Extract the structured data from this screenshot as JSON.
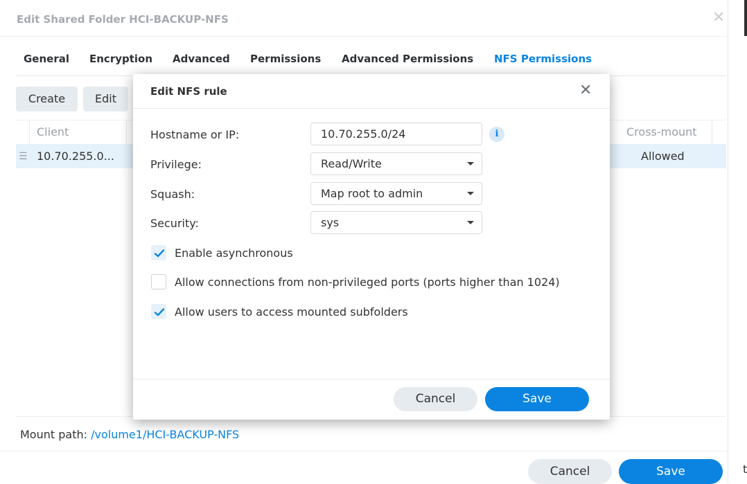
{
  "window": {
    "title": "Edit Shared Folder HCI-BACKUP-NFS",
    "close_icon": "close-icon"
  },
  "tabs": [
    {
      "label": "General"
    },
    {
      "label": "Encryption"
    },
    {
      "label": "Advanced"
    },
    {
      "label": "Permissions"
    },
    {
      "label": "Advanced Permissions"
    },
    {
      "label": "NFS Permissions",
      "active": true
    }
  ],
  "toolbar": {
    "create_label": "Create",
    "edit_label": "Edit"
  },
  "grid": {
    "columns": [
      "Client",
      "Cross-mount"
    ],
    "rows": [
      {
        "client": "10.70.255.0...",
        "cross_mount": "Allowed"
      }
    ]
  },
  "mount": {
    "label": "Mount path:",
    "path": "/volume1/HCI-BACKUP-NFS"
  },
  "footer": {
    "cancel_label": "Cancel",
    "save_label": "Save"
  },
  "dialog": {
    "title": "Edit NFS rule",
    "fields": {
      "hostname": {
        "label": "Hostname or IP:",
        "value": "10.70.255.0/24"
      },
      "privilege": {
        "label": "Privilege:",
        "value": "Read/Write"
      },
      "squash": {
        "label": "Squash:",
        "value": "Map root to admin"
      },
      "security": {
        "label": "Security:",
        "value": "sys"
      }
    },
    "options": [
      {
        "label": "Enable asynchronous",
        "checked": true
      },
      {
        "label": "Allow connections from non-privileged ports (ports higher than 1024)",
        "checked": false
      },
      {
        "label": "Allow users to access mounted subfolders",
        "checked": true
      }
    ],
    "cancel_label": "Cancel",
    "save_label": "Save"
  },
  "background_edge_text": "t",
  "colors": {
    "accent": "#0a84e0",
    "selected_row": "#e5f1fb",
    "button_gray": "#e6ebf0"
  }
}
